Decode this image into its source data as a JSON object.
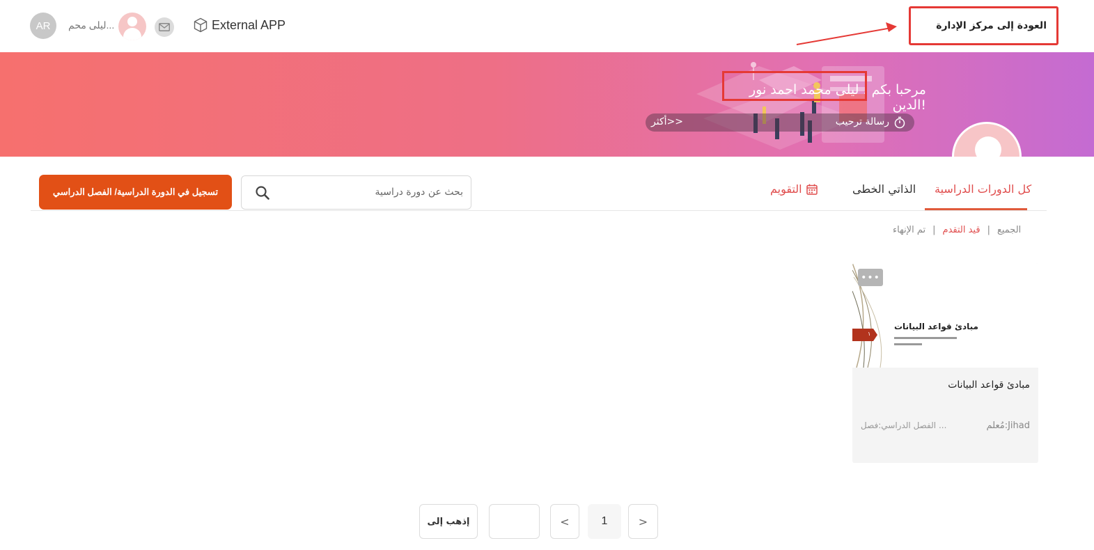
{
  "header": {
    "avatar_initials": "AR",
    "user_name": "ليلى محم...",
    "external_app_label": "External APP",
    "back_to_admin_label": "العودة إلى مركز الإدارة"
  },
  "banner": {
    "welcome_title": "مرحبا بكم ، ليلى محمد احمد نور الدين!",
    "welcome_message_label": "رسالة ترحيب",
    "more_label": "أكثر>>"
  },
  "tabs": {
    "all_courses": "كل الدورات الدراسية",
    "self_paced": "الذاتي الخطى",
    "calendar": "التقويم"
  },
  "search": {
    "placeholder": "بحث عن دورة دراسية"
  },
  "register_button_label": "تسجيل في الدورة الدراسية/ الفصل الدراسي",
  "filters": {
    "all": "الجميع",
    "in_progress": "قيد التقدم",
    "completed": "تم الإنهاء",
    "separator": "|"
  },
  "course": {
    "thumbnail_title": "مبادئ قواعد البيانات",
    "thumbnail_badge": "١",
    "more_icon_label": "•••",
    "name": "مبادئ قواعد البيانات",
    "teacher": "مُعلم:Jihad",
    "semester": "الفصل الدراسي:فصل ..."
  },
  "pagination": {
    "go_to_label": "إذهب إلى",
    "prev_label": "<",
    "current_page": "1",
    "next_label": ">"
  },
  "colors": {
    "accent_red": "#e04d4d",
    "register_orange": "#e25016",
    "highlight_red": "#e53935"
  }
}
